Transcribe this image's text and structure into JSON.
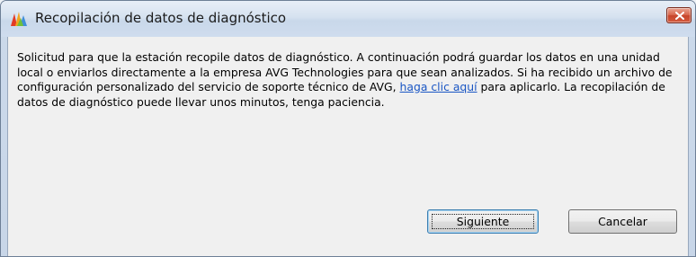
{
  "window": {
    "title": "Recopilación de datos de diagnóstico",
    "app_icon": "avg-logo-icon",
    "close_icon": "close-icon"
  },
  "message": {
    "text_before_link": "Solicitud para que la estación recopile datos de diagnóstico. A continuación podrá guardar los datos en una unidad local o enviarlos directamente a la empresa AVG Technologies para que sean analizados. Si ha recibido un archivo de configuración personalizado del servicio de soporte técnico de AVG, ",
    "link_text": "haga clic aquí",
    "text_after_link": " para aplicarlo. La recopilación de datos de diagnóstico puede llevar unos minutos, tenga paciencia."
  },
  "buttons": {
    "next_label": "Siguiente",
    "cancel_label": "Cancelar"
  },
  "colors": {
    "link": "#1a56c4",
    "close_button": "#c7452b"
  }
}
